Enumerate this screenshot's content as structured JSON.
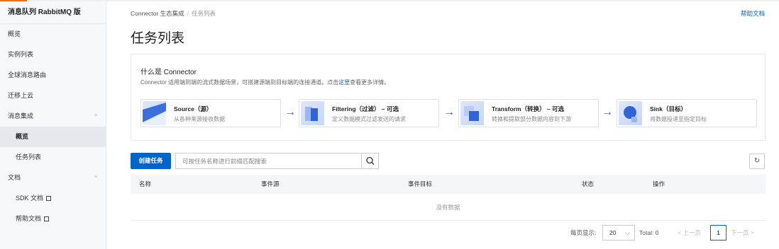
{
  "sidebar": {
    "title": "消息队列 RabbitMQ 版",
    "items": [
      {
        "label": "概览"
      },
      {
        "label": "实例列表"
      },
      {
        "label": "全球消息路由"
      },
      {
        "label": "迁移上云"
      },
      {
        "label": "消息集成",
        "chevron": "^"
      },
      {
        "label": "概览"
      },
      {
        "label": "任务列表"
      },
      {
        "label": "文档",
        "chevron": "^"
      },
      {
        "label": "SDK 文档"
      },
      {
        "label": "帮助文档"
      }
    ]
  },
  "breadcrumb": {
    "root": "Connector 生态集成",
    "separator": "/",
    "current": "任务列表"
  },
  "header": {
    "help_link": "帮助文档",
    "title": "任务列表"
  },
  "intro": {
    "title": "什么是 Connector",
    "desc_before": "Connector 适用端到端的流式数据场景，可搭建源端到目标端的连接通道。点击",
    "desc_link": "这里",
    "desc_after": "查看更多详情。",
    "steps": [
      {
        "label": "Source（源）",
        "desc": "从各种来源接收数据"
      },
      {
        "label": "Filtering（过滤） – 可选",
        "desc": "定义数据模式过滤发送的请求"
      },
      {
        "label": "Transform（转换） – 可选",
        "desc": "转换和提取部分数据内容到下游"
      },
      {
        "label": "Sink（目标）",
        "desc": "将数据投递至指定目标"
      }
    ],
    "arrow": "→"
  },
  "toolbar": {
    "create_label": "创建任务",
    "search_placeholder": "可按任务名称进行前缀匹配搜索",
    "refresh_glyph": "↻"
  },
  "table": {
    "columns": [
      "名称",
      "事件源",
      "事件目标",
      "状态",
      "操作"
    ],
    "empty_text": "没有数据"
  },
  "pagination": {
    "page_size_label": "每页显示:",
    "page_size": "20",
    "total": "Total: 0",
    "prev": "< 上一页",
    "current_page": "1",
    "next": "下一页 >"
  },
  "colors": {
    "accent": "#0064c8",
    "brand": "#ff6a00"
  }
}
